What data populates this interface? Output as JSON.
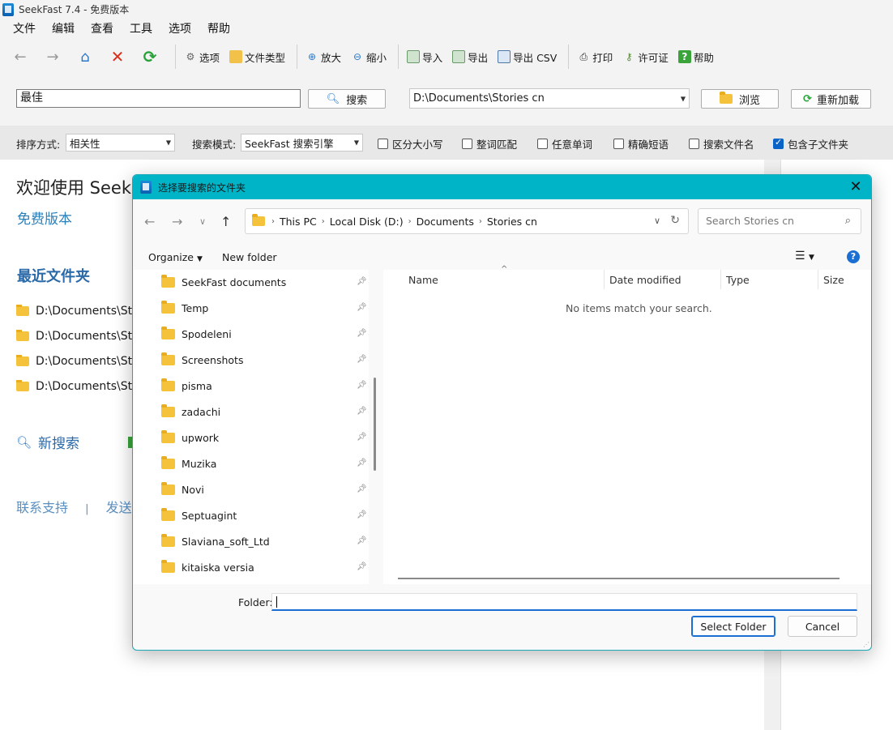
{
  "window": {
    "title": "SeekFast 7.4 - 免费版本"
  },
  "menu": [
    "文件",
    "编辑",
    "查看",
    "工具",
    "选项",
    "帮助"
  ],
  "toolbar": {
    "options": "选项",
    "file_types": "文件类型",
    "zoom_in": "放大",
    "zoom_out": "缩小",
    "import": "导入",
    "export": "导出",
    "export_csv": "导出 CSV",
    "print": "打印",
    "license": "许可证",
    "help": "帮助"
  },
  "search": {
    "query": "最佳",
    "button": "搜索",
    "folder": "D:\\Documents\\Stories cn",
    "browse": "浏览",
    "reload": "重新加载"
  },
  "options": {
    "sort_label": "排序方式:",
    "sort_value": "相关性",
    "mode_label": "搜索模式:",
    "mode_value": "SeekFast 搜索引擎",
    "case": "区分大小写",
    "whole_word": "整词匹配",
    "any_word": "任意单词",
    "exact_phrase": "精确短语",
    "filename": "搜索文件名",
    "subfolders": "包含子文件夹",
    "subfolders_checked": true
  },
  "home": {
    "welcome": "欢迎使用  SeekFast",
    "free": "免费版本",
    "recent_title": "最近文件夹",
    "recent": [
      "D:\\Documents\\Stories cn",
      "D:\\Documents\\Stories cn",
      "D:\\Documents\\Stories cn",
      "D:\\Documents\\Stories cn"
    ],
    "new_search": "新搜索",
    "support": "联系支持",
    "sep": "|",
    "feedback": "发送反馈"
  },
  "dialog": {
    "title": "选择要搜索的文件夹",
    "breadcrumb": [
      "This PC",
      "Local Disk (D:)",
      "Documents",
      "Stories cn"
    ],
    "search_placeholder": "Search Stories cn",
    "organize": "Organize",
    "new_folder": "New folder",
    "nav_items": [
      "SeekFast documents",
      "Temp",
      "Spodeleni",
      "Screenshots",
      "pisma",
      "zadachi",
      "upwork",
      "Muzika",
      "Novi",
      "Septuagint",
      "Slaviana_soft_Ltd",
      "kitaiska versia"
    ],
    "columns": [
      "Name",
      "Date modified",
      "Type",
      "Size"
    ],
    "empty": "No items match your search.",
    "folder_label": "Folder:",
    "folder_value": "",
    "select": "Select Folder",
    "cancel": "Cancel"
  }
}
